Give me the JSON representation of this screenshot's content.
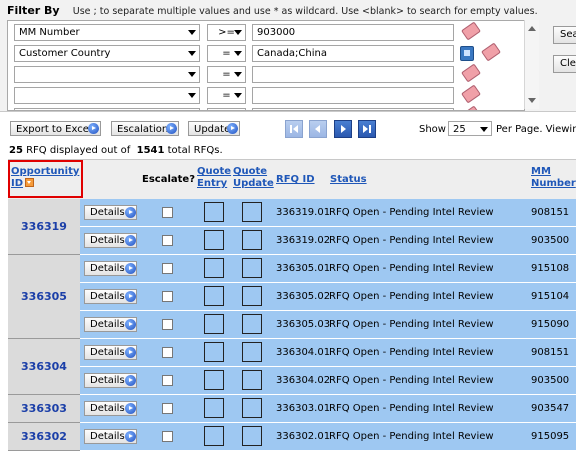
{
  "filter": {
    "title": "Filter By",
    "hint": "Use ; to separate multiple values and use * as wildcard. Use <blank> to search for empty values.",
    "rows": [
      {
        "field": "MM Number",
        "op": ">=",
        "value": "903000"
      },
      {
        "field": "Customer Country",
        "op": "=",
        "value": "Canada;China"
      },
      {
        "field": "",
        "op": "=",
        "value": ""
      },
      {
        "field": "",
        "op": "=",
        "value": ""
      },
      {
        "field": "",
        "op": "=",
        "value": ""
      }
    ],
    "search_button": "Search",
    "clear_button": "Clear"
  },
  "toolbar": {
    "export_label": "Export to Excel",
    "escalation_label": "Escalation",
    "update_label": "Update",
    "show_label": "Show",
    "page_size": "25",
    "per_page_label": "Per Page. Viewing"
  },
  "summary": {
    "displayed": "25",
    "displayed_text": "RFQ displayed out of",
    "total": "1541",
    "total_text": "total RFQs."
  },
  "grid": {
    "headers": {
      "opportunity_id": "Opportunity ID",
      "escalate": "Escalate?",
      "quote_entry": "Quote Entry",
      "quote_update": "Quote Update",
      "rfq_id": "RFQ ID",
      "status": "Status",
      "mm_number": "MM Number"
    },
    "details_label": "Details",
    "groups": [
      {
        "opp_id": "336319",
        "rows": [
          {
            "rfq_id": "336319.01",
            "status": "RFQ Open - Pending Intel Review",
            "mm": "908151"
          },
          {
            "rfq_id": "336319.02",
            "status": "RFQ Open - Pending Intel Review",
            "mm": "903500"
          }
        ]
      },
      {
        "opp_id": "336305",
        "rows": [
          {
            "rfq_id": "336305.01",
            "status": "RFQ Open - Pending Intel Review",
            "mm": "915108"
          },
          {
            "rfq_id": "336305.02",
            "status": "RFQ Open - Pending Intel Review",
            "mm": "915104"
          },
          {
            "rfq_id": "336305.03",
            "status": "RFQ Open - Pending Intel Review",
            "mm": "915090"
          }
        ]
      },
      {
        "opp_id": "336304",
        "rows": [
          {
            "rfq_id": "336304.01",
            "status": "RFQ Open - Pending Intel Review",
            "mm": "908151"
          },
          {
            "rfq_id": "336304.02",
            "status": "RFQ Open - Pending Intel Review",
            "mm": "903500"
          }
        ]
      },
      {
        "opp_id": "336303",
        "rows": [
          {
            "rfq_id": "336303.01",
            "status": "RFQ Open - Pending Intel Review",
            "mm": "903547"
          }
        ]
      },
      {
        "opp_id": "336302",
        "rows": [
          {
            "rfq_id": "336302.01",
            "status": "RFQ Open - Pending Intel Review",
            "mm": "915095"
          }
        ]
      }
    ]
  },
  "colors": {
    "row_blue": "#9ec8f2",
    "link_blue": "#1f57b8",
    "sort_highlight": "#e00000"
  }
}
